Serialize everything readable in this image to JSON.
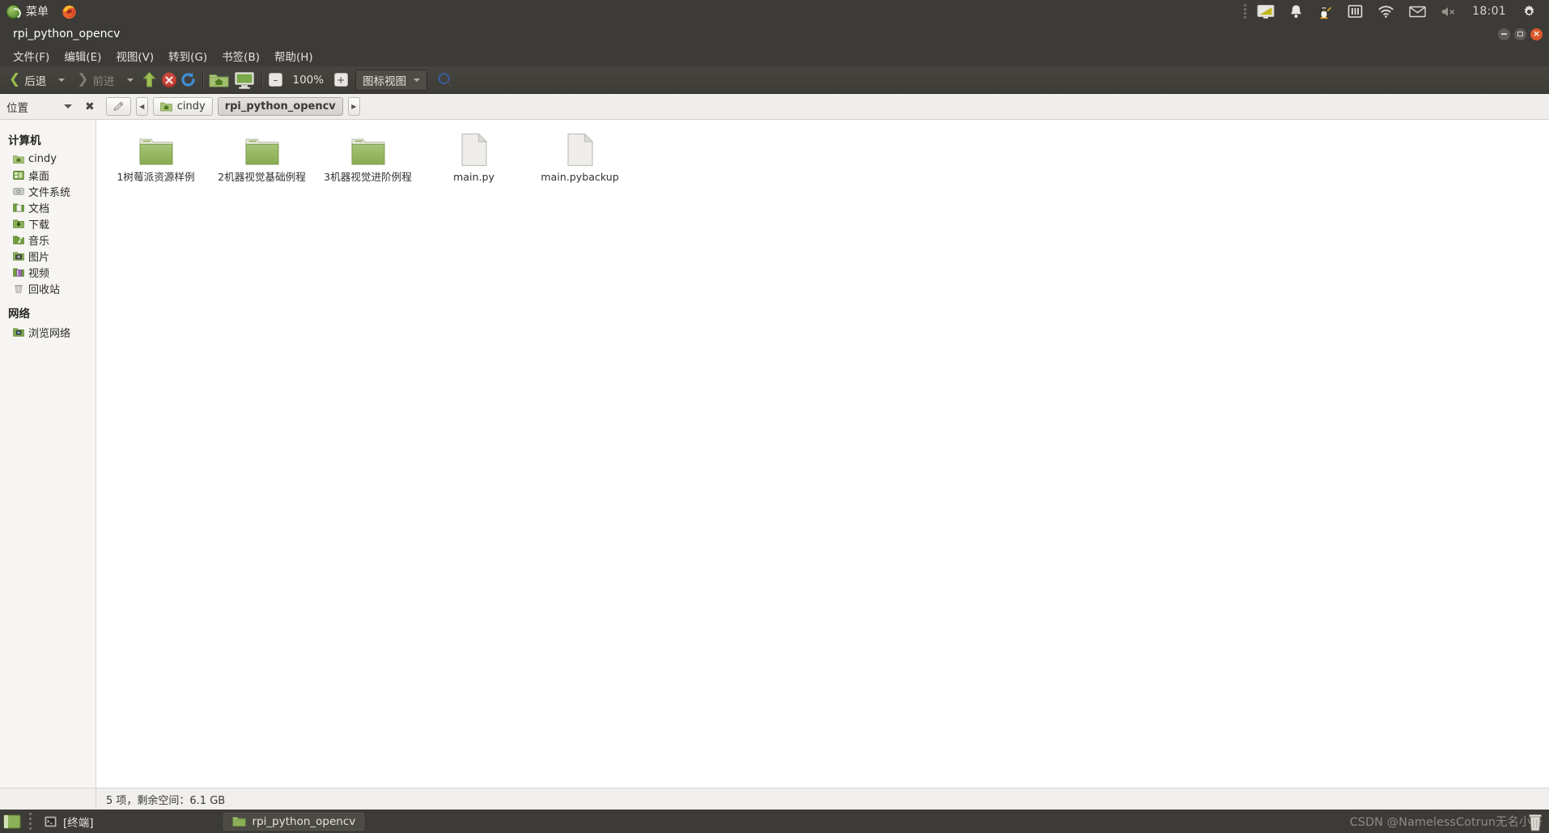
{
  "panel": {
    "menu_label": "菜单",
    "menu_orb_icon": "mint-menu-icon",
    "firefox_icon": "firefox-icon",
    "clock": "18:01",
    "tray": [
      {
        "name": "display-icon",
        "title": "显示"
      },
      {
        "name": "bell-icon",
        "title": "通知"
      },
      {
        "name": "tux-penguin-icon",
        "title": "Linux"
      },
      {
        "name": "keyboard-icon",
        "title": "输入法"
      },
      {
        "name": "wifi-icon",
        "title": "网络"
      },
      {
        "name": "mail-icon",
        "title": "邮件"
      },
      {
        "name": "volume-muted-icon",
        "title": "音量"
      },
      {
        "name": "settings-gear-icon",
        "title": "设置"
      }
    ]
  },
  "window": {
    "title": "rpi_python_opencv",
    "buttons": {
      "minimize": "最小化",
      "maximize": "最大化",
      "close": "×"
    }
  },
  "menubar": [
    {
      "label": "文件(F)",
      "name": "menu-file"
    },
    {
      "label": "编辑(E)",
      "name": "menu-edit"
    },
    {
      "label": "视图(V)",
      "name": "menu-view"
    },
    {
      "label": "转到(G)",
      "name": "menu-go"
    },
    {
      "label": "书签(B)",
      "name": "menu-bookmarks"
    },
    {
      "label": "帮助(H)",
      "name": "menu-help"
    }
  ],
  "toolbar": {
    "back_label": "后退",
    "forward_label": "前进",
    "up_icon": "arrow-up-icon",
    "stop_icon": "stop-icon",
    "reload_icon": "reload-icon",
    "home_icon": "home-folder-icon",
    "computer_icon": "computer-icon",
    "zoom_out_glyph": "–",
    "zoom_level": "100%",
    "zoom_in_glyph": "+",
    "view_mode": "图标视图",
    "search_icon": "search-icon"
  },
  "location": {
    "label": "位置",
    "clear_glyph": "✖",
    "edit_icon": "pencil-icon",
    "prev_glyph": "◀",
    "next_glyph": "▶",
    "crumbs": [
      {
        "label": "cindy",
        "name": "breadcrumb-cindy",
        "current": false
      },
      {
        "label": "rpi_python_opencv",
        "name": "breadcrumb-rpi-python-opencv",
        "current": true
      }
    ]
  },
  "sidebar": {
    "groups": [
      {
        "title": "计算机",
        "items": [
          {
            "label": "cindy",
            "icon": "home-folder-icon"
          },
          {
            "label": "桌面",
            "icon": "desktop-icon"
          },
          {
            "label": "文件系统",
            "icon": "harddisk-icon"
          },
          {
            "label": "文档",
            "icon": "documents-folder-icon"
          },
          {
            "label": "下载",
            "icon": "downloads-folder-icon"
          },
          {
            "label": "音乐",
            "icon": "music-folder-icon"
          },
          {
            "label": "图片",
            "icon": "pictures-folder-icon"
          },
          {
            "label": "视频",
            "icon": "videos-folder-icon"
          },
          {
            "label": "回收站",
            "icon": "trash-icon"
          }
        ]
      },
      {
        "title": "网络",
        "items": [
          {
            "label": "浏览网络",
            "icon": "network-browse-icon"
          }
        ]
      }
    ]
  },
  "files": [
    {
      "name": "1树莓派资源样例",
      "type": "folder"
    },
    {
      "name": "2机器视觉基础例程",
      "type": "folder"
    },
    {
      "name": "3机器视觉进阶例程",
      "type": "folder"
    },
    {
      "name": "main.py",
      "type": "file"
    },
    {
      "name": "main.pybackup",
      "type": "file"
    }
  ],
  "status": {
    "text": "5 项，剩余空间：6.1 GB"
  },
  "taskbar": {
    "items": [
      {
        "label": "[终端]",
        "icon": "terminal-icon",
        "active": false
      },
      {
        "label": "rpi_python_opencv",
        "icon": "folder-icon",
        "active": true
      }
    ],
    "watermark": "CSDN @NamelessCotrun无名小哥",
    "trash_icon": "trash-icon"
  },
  "colors": {
    "panel_bg": "#3c3b37",
    "window_bg": "#f6f5f3",
    "folder_green": "#8cb058",
    "close_button": "#d9582b",
    "accent_green": "#9bbf4e"
  }
}
